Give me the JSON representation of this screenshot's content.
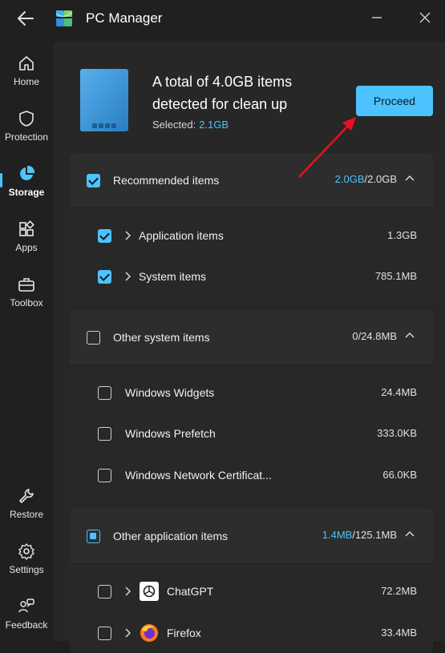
{
  "app": {
    "title": "PC Manager"
  },
  "sidebar": {
    "items": [
      {
        "label": "Home",
        "icon": "home-icon"
      },
      {
        "label": "Protection",
        "icon": "shield-icon"
      },
      {
        "label": "Storage",
        "icon": "pie-chart-icon",
        "active": true
      },
      {
        "label": "Apps",
        "icon": "apps-icon"
      },
      {
        "label": "Toolbox",
        "icon": "toolbox-icon"
      },
      {
        "label": "Restore",
        "icon": "wrench-icon"
      },
      {
        "label": "Settings",
        "icon": "gear-icon"
      },
      {
        "label": "Feedback",
        "icon": "feedback-icon"
      }
    ]
  },
  "summary": {
    "headline": "A total of 4.0GB items detected for clean up",
    "selected_label": "Selected:",
    "selected_value": "2.1GB",
    "proceed_label": "Proceed"
  },
  "sections": {
    "recommended": {
      "label": "Recommended items",
      "size_selected": "2.0GB",
      "size_total": "/2.0GB",
      "items": [
        {
          "label": "Application items",
          "size": "1.3GB"
        },
        {
          "label": "System items",
          "size": "785.1MB"
        }
      ]
    },
    "other_system": {
      "label": "Other system items",
      "size_selected": "0",
      "size_total": "/24.8MB",
      "items": [
        {
          "label": "Windows Widgets",
          "size": "24.4MB"
        },
        {
          "label": "Windows Prefetch",
          "size": "333.0KB"
        },
        {
          "label": "Windows Network Certificat...",
          "size": "66.0KB"
        }
      ]
    },
    "other_apps": {
      "label": "Other application items",
      "size_selected": "1.4MB",
      "size_total": "/125.1MB",
      "items": [
        {
          "label": "ChatGPT",
          "size": "72.2MB"
        },
        {
          "label": "Firefox",
          "size": "33.4MB"
        }
      ]
    }
  },
  "colors": {
    "accent": "#4cc2ff",
    "background": "#202020",
    "panel": "#2d2d2d",
    "annotation_arrow": "#e81123"
  }
}
